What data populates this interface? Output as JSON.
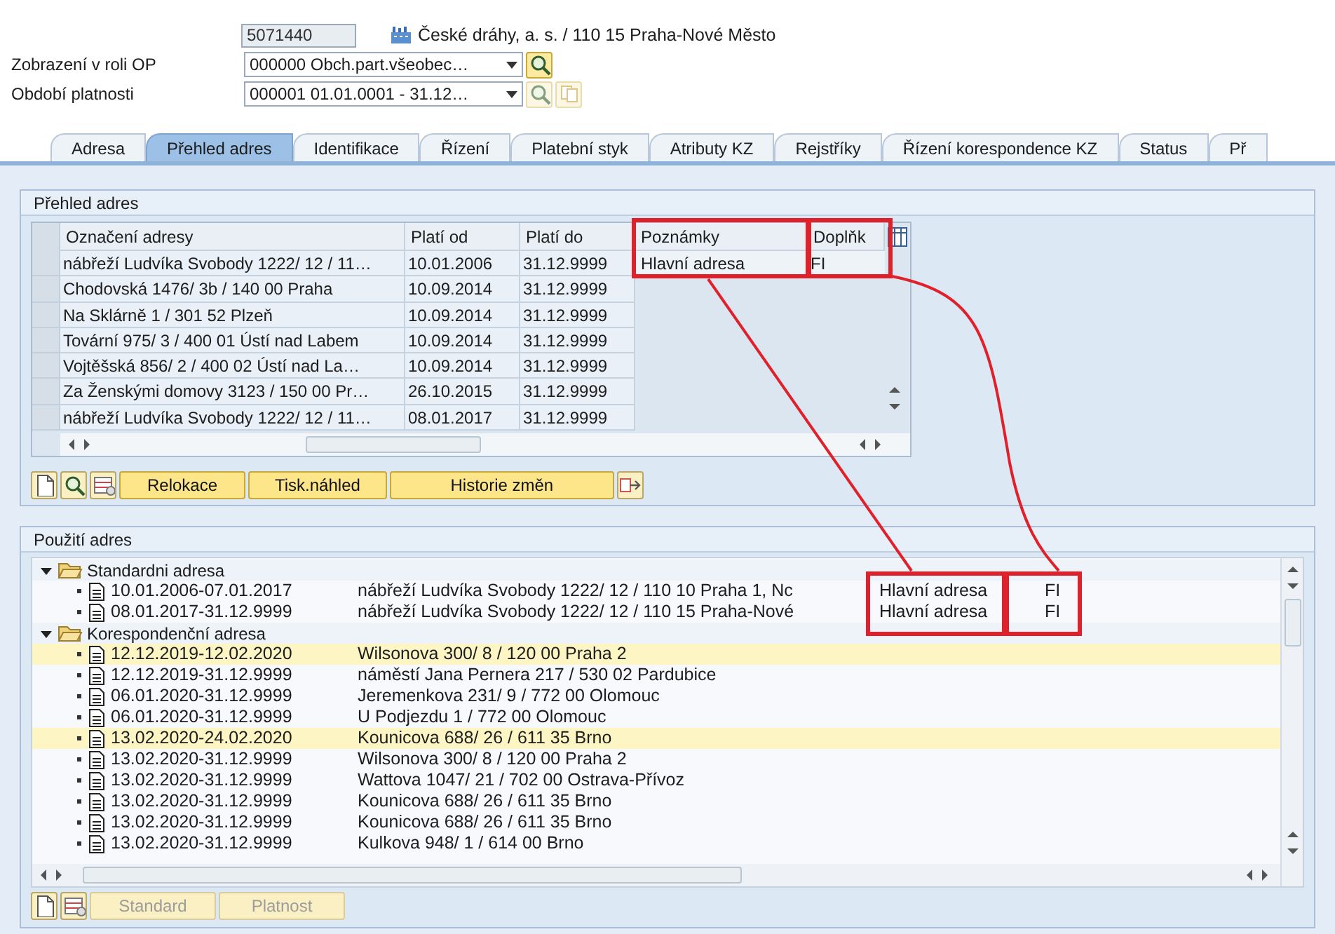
{
  "header": {
    "partner_number": "5071440",
    "partner_name": "České dráhy, a. s. / 110 15 Praha-Nové Město",
    "fields": [
      {
        "label": "Zobrazení v roli OP",
        "value": "000000 Obch.part.všeobec…",
        "buttons": [
          {
            "disabled": false
          }
        ]
      },
      {
        "label": "Období platnosti",
        "value": "000001 01.01.0001 - 31.12…",
        "buttons": [
          {
            "disabled": true
          },
          {
            "disabled": true
          }
        ]
      }
    ]
  },
  "tabs": [
    {
      "label": "Adresa",
      "selected": false
    },
    {
      "label": "Přehled adres",
      "selected": true
    },
    {
      "label": "Identifikace",
      "selected": false
    },
    {
      "label": "Řízení",
      "selected": false
    },
    {
      "label": "Platební styk",
      "selected": false
    },
    {
      "label": "Atributy KZ",
      "selected": false
    },
    {
      "label": "Rejstříky",
      "selected": false
    },
    {
      "label": "Řízení korespondence KZ",
      "selected": false
    },
    {
      "label": "Status",
      "selected": false
    },
    {
      "label": "Př",
      "selected": false
    }
  ],
  "overview": {
    "title": "Přehled adres",
    "columns": [
      "Označení adresy",
      "Platí od",
      "Platí do",
      "Poznámky",
      "Doplňk"
    ],
    "rows": [
      {
        "address": "nábřeží Ludvíka Svobody 1222/ 12 / 11…",
        "from": "10.01.2006",
        "to": "31.12.9999",
        "note": "Hlavní adresa",
        "addition": "FI"
      },
      {
        "address": "Chodovská 1476/ 3b / 140 00 Praha",
        "from": "10.09.2014",
        "to": "31.12.9999"
      },
      {
        "address": "Na Sklárně 1 / 301 52 Plzeň",
        "from": "10.09.2014",
        "to": "31.12.9999"
      },
      {
        "address": "Tovární 975/ 3 / 400 01 Ústí nad Labem",
        "from": "10.09.2014",
        "to": "31.12.9999"
      },
      {
        "address": "Vojtěšská 856/ 2 / 400 02 Ústí nad La…",
        "from": "10.09.2014",
        "to": "31.12.9999"
      },
      {
        "address": "Za Ženskými domovy 3123 / 150 00 Pr…",
        "from": "26.10.2015",
        "to": "31.12.9999"
      },
      {
        "address": "nábřeží Ludvíka Svobody 1222/ 12 / 11…",
        "from": "08.01.2017",
        "to": "31.12.9999"
      }
    ],
    "buttons": [
      {
        "kind": "new"
      },
      {
        "kind": "find"
      },
      {
        "kind": "table"
      },
      {
        "kind": "text",
        "label": "Relokace",
        "disabled": false
      },
      {
        "kind": "text",
        "label": "Tisk.náhled",
        "disabled": false
      },
      {
        "kind": "text",
        "label": "Historie změn",
        "disabled": false
      },
      {
        "kind": "export"
      }
    ]
  },
  "usage": {
    "title": "Použití adres",
    "groups": [
      {
        "label": "Standardni adresa",
        "expanded": true,
        "children": [
          {
            "period": "10.01.2006-07.01.2017",
            "address": "nábřeží Ludvíka Svobody 1222/ 12 / 110 10 Praha 1, Nc",
            "note": "Hlavní adresa",
            "addition": "FI",
            "highlighted": false
          },
          {
            "period": "08.01.2017-31.12.9999",
            "address": "nábřeží Ludvíka Svobody 1222/ 12 / 110 15 Praha-Nové",
            "note": "Hlavní adresa",
            "addition": "FI",
            "highlighted": false
          }
        ]
      },
      {
        "label": "Korespondenční adresa",
        "expanded": true,
        "children": [
          {
            "period": "12.12.2019-12.02.2020",
            "address": "Wilsonova 300/ 8 / 120 00 Praha 2",
            "highlighted": true
          },
          {
            "period": "12.12.2019-31.12.9999",
            "address": "náměstí Jana Pernera 217 / 530 02 Pardubice",
            "highlighted": false
          },
          {
            "period": "06.01.2020-31.12.9999",
            "address": "Jeremenkova 231/ 9 / 772 00 Olomouc",
            "highlighted": false
          },
          {
            "period": "06.01.2020-31.12.9999",
            "address": "U Podjezdu 1 / 772 00 Olomouc",
            "highlighted": false
          },
          {
            "period": "13.02.2020-24.02.2020",
            "address": "Kounicova 688/ 26 / 611 35 Brno",
            "highlighted": true
          },
          {
            "period": "13.02.2020-31.12.9999",
            "address": "Wilsonova 300/ 8 / 120 00 Praha 2",
            "highlighted": false
          },
          {
            "period": "13.02.2020-31.12.9999",
            "address": "Wattova 1047/ 21 / 702 00 Ostrava-Přívoz",
            "highlighted": false
          },
          {
            "period": "13.02.2020-31.12.9999",
            "address": "Kounicova 688/ 26 / 611 35 Brno",
            "highlighted": false
          },
          {
            "period": "13.02.2020-31.12.9999",
            "address": "Kounicova 688/ 26 / 611 35 Brno",
            "highlighted": false
          },
          {
            "period": "13.02.2020-31.12.9999",
            "address": "Kulkova 948/ 1 / 614 00 Brno",
            "highlighted": false
          }
        ]
      }
    ],
    "buttons": [
      {
        "kind": "new"
      },
      {
        "kind": "table"
      },
      {
        "kind": "text",
        "label": "Standard",
        "disabled": true
      },
      {
        "kind": "text",
        "label": "Platnost",
        "disabled": true
      }
    ]
  }
}
